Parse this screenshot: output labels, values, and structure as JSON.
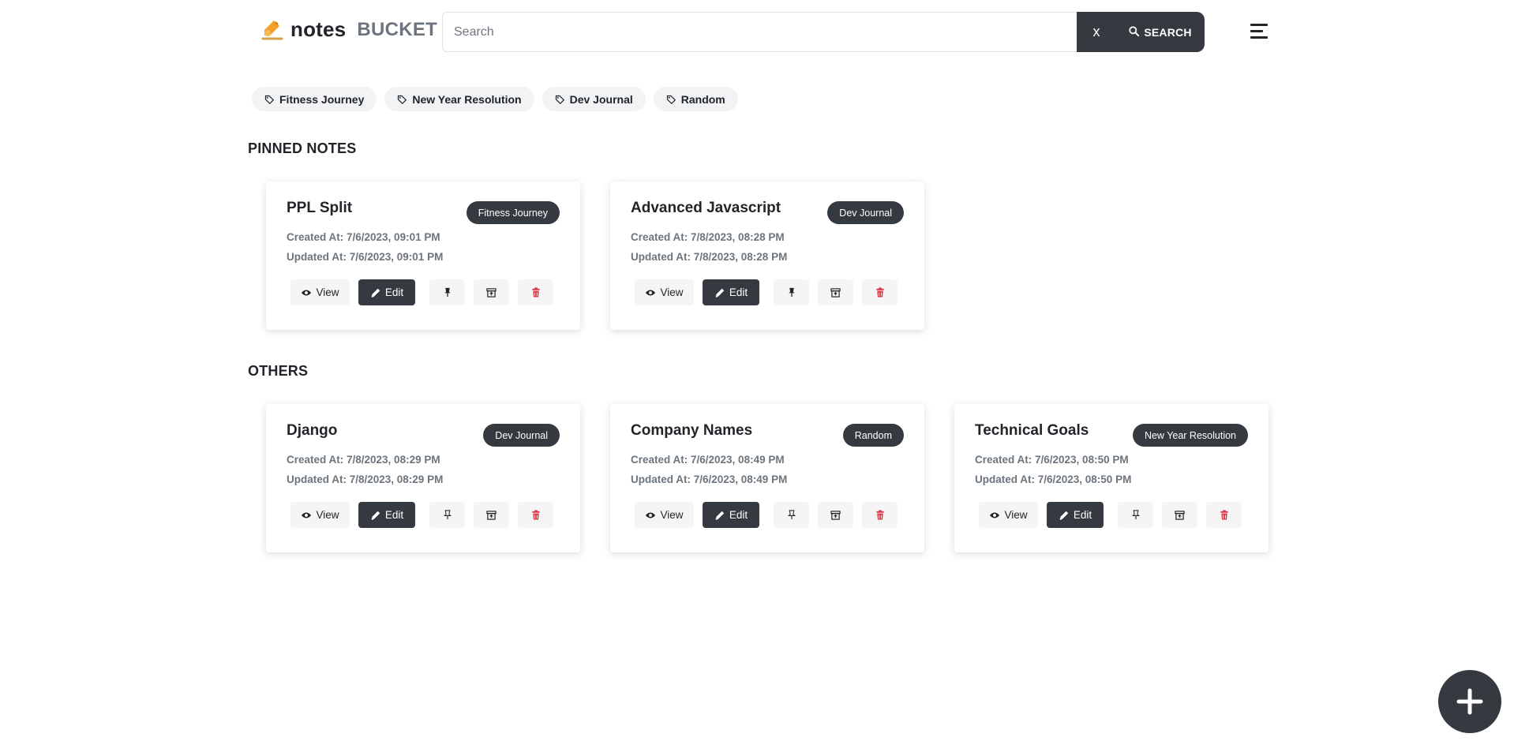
{
  "brand": {
    "name": "notes",
    "sub": "BUCKET"
  },
  "search": {
    "placeholder": "Search",
    "value": "",
    "clear_label": "x",
    "button_label": "SEARCH"
  },
  "tags": [
    {
      "label": "Fitness Journey"
    },
    {
      "label": "New Year Resolution"
    },
    {
      "label": "Dev Journal"
    },
    {
      "label": "Random"
    }
  ],
  "sections": {
    "pinned": "PINNED NOTES",
    "others": "OTHERS"
  },
  "pinned_notes": [
    {
      "title": "PPL Split",
      "tag": "Fitness Journey",
      "created": "Created At: 7/6/2023, 09:01 PM",
      "updated": "Updated At: 7/6/2023, 09:01 PM"
    },
    {
      "title": "Advanced Javascript",
      "tag": "Dev Journal",
      "created": "Created At: 7/8/2023, 08:28 PM",
      "updated": "Updated At: 7/8/2023, 08:28 PM"
    }
  ],
  "other_notes": [
    {
      "title": "Django",
      "tag": "Dev Journal",
      "created": "Created At: 7/8/2023, 08:29 PM",
      "updated": "Updated At: 7/8/2023, 08:29 PM"
    },
    {
      "title": "Company Names",
      "tag": "Random",
      "created": "Created At: 7/6/2023, 08:49 PM",
      "updated": "Updated At: 7/6/2023, 08:49 PM"
    },
    {
      "title": "Technical Goals",
      "tag": "New Year Resolution",
      "created": "Created At: 7/6/2023, 08:50 PM",
      "updated": "Updated At: 7/6/2023, 08:50 PM"
    }
  ],
  "actions": {
    "view_label": "View",
    "edit_label": "Edit"
  },
  "icons": {
    "brand": "writing-hand-icon",
    "search": "magnifier-icon",
    "menu": "hamburger-menu-icon",
    "tag": "tag-icon",
    "view": "eye-icon",
    "edit": "pencil-icon",
    "pin": "pin-icon",
    "archive": "archive-box-icon",
    "delete": "trash-icon",
    "add": "plus-icon"
  },
  "colors": {
    "dark": "#343a40",
    "muted": "#6c757d",
    "chip_bg": "#f1f3f5",
    "danger": "#dc3545",
    "brand_icon": "#f4a12b"
  }
}
